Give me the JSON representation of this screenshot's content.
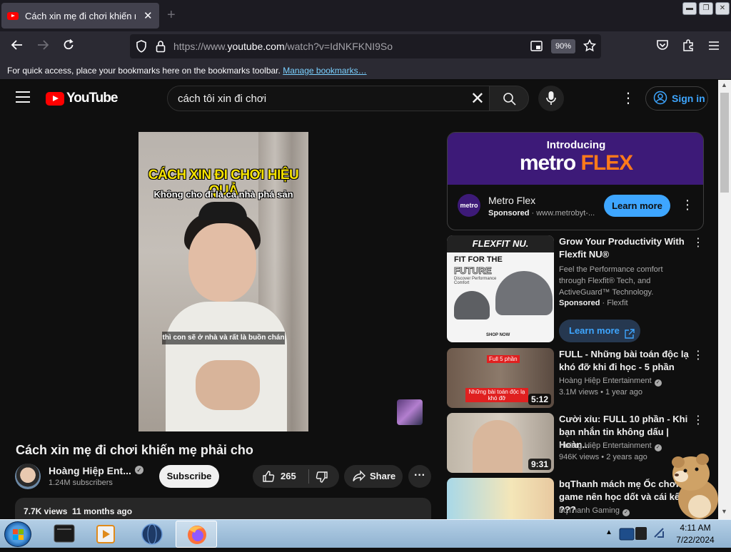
{
  "browser": {
    "tab_title": "Cách xin mẹ đi chơi khiến mẹ phải cho",
    "url_prefix": "https://www.",
    "url_domain": "youtube.com",
    "url_path": "/watch?v=IdNKFKNI9So",
    "zoom": "90%",
    "bookmarks_msg": "For quick access, place your bookmarks here on the bookmarks toolbar.",
    "bookmarks_link": "Manage bookmarks…"
  },
  "youtube": {
    "logo_text": "YouTube",
    "search_query": "cách tôi xin đi chơi",
    "sign_in": "Sign in"
  },
  "video": {
    "overlay_title": "CÁCH XIN ĐI CHƠI HIỆU QUẢ",
    "overlay_subtitle": "Không cho đi là cả nhà phá sản",
    "caption": "thì con sẽ ở nhà và rất là buồn chán",
    "title": "Cách xin mẹ đi chơi khiến mẹ phải cho",
    "channel_name": "Hoàng Hiệp Ent...",
    "subscribers": "1.24M subscribers",
    "subscribe_label": "Subscribe",
    "likes": "265",
    "share_label": "Share",
    "views": "7.7K views",
    "age": "11 months ago"
  },
  "ad": {
    "intro": "Introducing",
    "brand_main": "metro",
    "brand_accent": "FLEX",
    "logo_text": "metro",
    "title": "Metro Flex",
    "sponsored": "Sponsored",
    "domain": "www.metrobyt-...",
    "learn_more": "Learn more"
  },
  "sidebar": {
    "flexfit": {
      "band": "FLEXFIT NU.",
      "fit": "FIT FOR THE",
      "future": "FUTURE",
      "discover": "Discover Performance Comfort",
      "shop": "SHOP NOW",
      "title": "Grow Your Productivity With Flexfit NU®",
      "desc": "Feel the Performance comfort through Flexfit® Tech, and ActiveGuard™ Technology.",
      "sponsored": "Sponsored",
      "advertiser": "Flexfit",
      "learn_more": "Learn more"
    },
    "videos": [
      {
        "title": "FULL - Những bài toán độc lạ khó đỡ khi đi học - 5 phần",
        "channel": "Hoàng Hiệp Entertainment",
        "meta": "3.1M views • 1 year ago",
        "duration": "5:12",
        "thumb_tag": "Full 5 phần",
        "thumb_text": "Những bài toán độc lạ khó đỡ"
      },
      {
        "title": "Cười xỉu: FULL 10 phần - Khi bạn nhắn tin không dấu | Hoàn...",
        "channel": "Hoàng Hiệp Entertainment",
        "meta": "946K views • 2 years ago",
        "duration": "9:31"
      },
      {
        "title": "bqThanh mách mẹ Ốc chơi game nên học dốt và cái kết ???",
        "channel": "bqThanh Gaming",
        "meta": ""
      }
    ]
  },
  "taskbar": {
    "time": "4:11 AM",
    "date": "7/22/2024"
  },
  "colors": {
    "yt_bg": "#0f0f0f",
    "yt_red": "#ff0000",
    "link_blue": "#3ea6ff",
    "metro_purple": "#3d1a78",
    "metro_orange": "#ff7a1a"
  }
}
